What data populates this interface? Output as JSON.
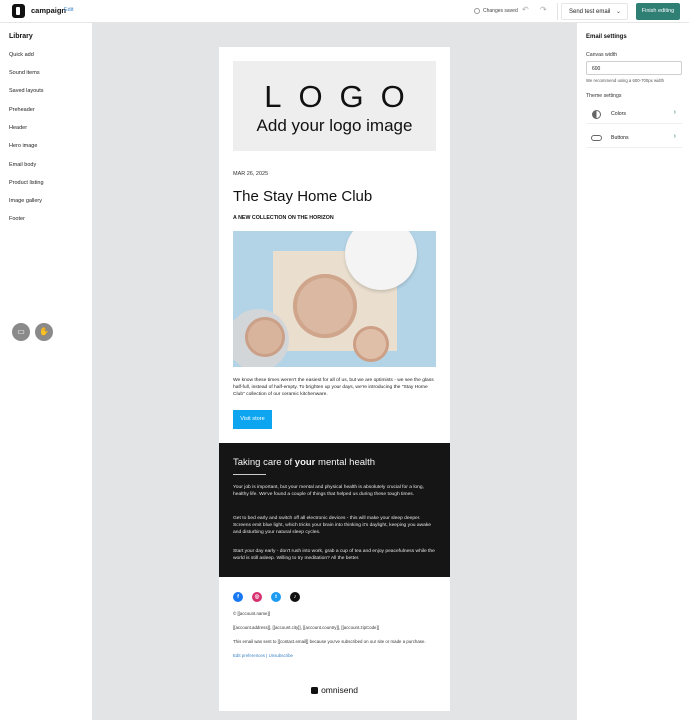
{
  "header": {
    "title": "campaign",
    "edit_label": "Edit",
    "status": "Changes saved",
    "send_test_label": "Send test email",
    "finish_label": "Finish editing"
  },
  "sidebar": {
    "title": "Library",
    "items": [
      {
        "label": "Quick add"
      },
      {
        "label": "Sound items"
      },
      {
        "label": "Saved layouts"
      },
      {
        "label": "Preheader"
      },
      {
        "label": "Header"
      },
      {
        "label": "Hero image"
      },
      {
        "label": "Email body"
      },
      {
        "label": "Product listing"
      },
      {
        "label": "Image gallery"
      },
      {
        "label": "Footer"
      }
    ]
  },
  "email": {
    "logo_text": "LOGO",
    "logo_sub": "Add your logo image",
    "date": "MAR 26, 2025",
    "title": "The Stay Home Club",
    "subtitle": "A NEW COLLECTION ON THE HORIZON",
    "body": "We know these times weren't the easiest for all of us, but we are optimists - we see the glass half-full, instead of half-empty. To brighten up your days, we're introducing the \"Stay Home Club\" collection of our ceramic kitchenware.",
    "button_label": "Visit store",
    "dark_title_pre": "Taking care of ",
    "dark_title_bold": "your",
    "dark_title_post": " mental health",
    "dark_paragraphs": [
      "Your job is important, but your mental and physical health is absolutely crucial for a long, healthy life. We've found a couple of things that helped us during these tough times.",
      "Get to bed early and switch off all electronic devices - this will make your sleep deeper. Screens emit blue light, which tricks your brain into thinking it's daylight, keeping you awake and disturbing your natural sleep cycles.",
      "Start your day early - don't rush into work, grab a cup of tea and enjoy peacefulness while the world is still asleep. Willing to try meditation? All the better."
    ],
    "footer": {
      "copyright": "© [[account.name]]",
      "address": "[[account.address]], [[account.city]], [[account.country]], [[account.zipCode]]",
      "notice": "This email was sent to [[contact.email]] because you've subscribed on our site or made a purchase.",
      "pref_link": "Edit preferences",
      "separator": " | ",
      "unsub_link": "Unsubscribe",
      "brand": "omnisend"
    },
    "social": [
      {
        "icon": "facebook-icon",
        "glyph": "f",
        "color": "#1877f2"
      },
      {
        "icon": "instagram-icon",
        "glyph": "◎",
        "color": "#d6306f"
      },
      {
        "icon": "twitter-icon",
        "glyph": "t",
        "color": "#1d9bf0"
      },
      {
        "icon": "tiktok-icon",
        "glyph": "♪",
        "color": "#111111"
      }
    ]
  },
  "settings": {
    "title": "Email settings",
    "canvas_width_label": "Canvas width",
    "canvas_width_value": "600",
    "hint": "We recommend using a 600-700px width",
    "theme_label": "Theme settings",
    "colors_label": "Colors",
    "buttons_label": "Buttons"
  },
  "colors": {
    "accent": "#2f7f74",
    "button": "#0ea5f0",
    "dark_section": "#151515",
    "canvas_bg": "#e2e4e6"
  }
}
